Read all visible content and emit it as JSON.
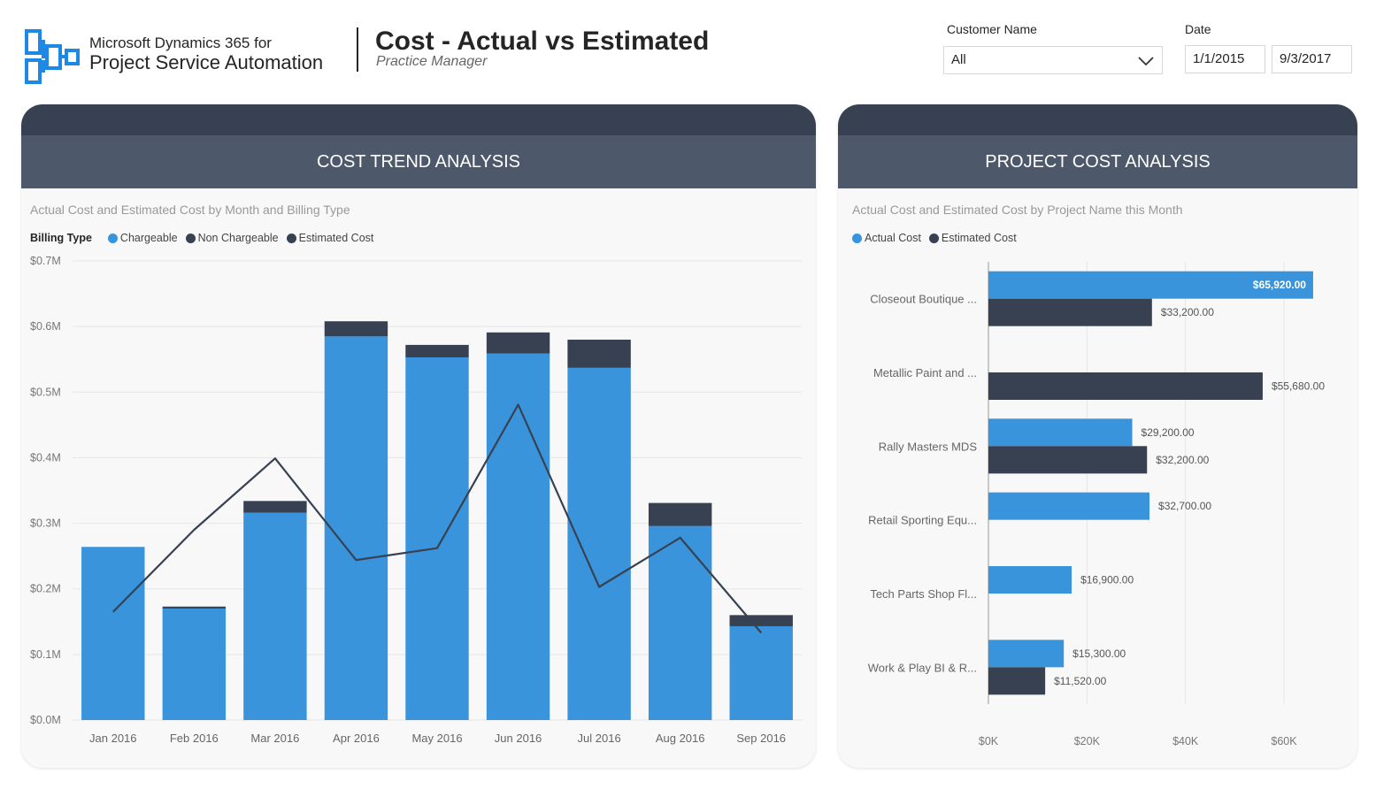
{
  "header": {
    "brand_line1": "Microsoft Dynamics 365 for",
    "brand_line2": "Project Service Automation",
    "title": "Cost - Actual vs Estimated",
    "subtitle": "Practice Manager"
  },
  "filters": {
    "customer_label": "Customer Name",
    "customer_value": "All",
    "date_label": "Date",
    "date_start": "1/1/2015",
    "date_end": "9/3/2017"
  },
  "colors": {
    "actual": "#3a94db",
    "estimated": "#374151",
    "header_bar": "#4d596b"
  },
  "panels": {
    "left": {
      "heading": "COST TREND ANALYSIS",
      "subtitle": "Actual Cost and Estimated Cost by Month and Billing Type",
      "legend_title": "Billing Type",
      "legend": [
        "Chargeable",
        "Non Chargeable",
        "Estimated Cost"
      ]
    },
    "right": {
      "heading": "PROJECT COST ANALYSIS",
      "subtitle": "Actual Cost and Estimated Cost by Project Name this Month",
      "legend": [
        "Actual Cost",
        "Estimated Cost"
      ]
    }
  },
  "chart_data": [
    {
      "type": "bar",
      "stacked": true,
      "categories": [
        "Jan 2016",
        "Feb 2016",
        "Mar 2016",
        "Apr 2016",
        "May 2016",
        "Jun 2016",
        "Jul 2016",
        "Aug 2016",
        "Sep 2016"
      ],
      "series": [
        {
          "name": "Chargeable",
          "kind": "bar",
          "values": [
            0.264,
            0.17,
            0.316,
            0.585,
            0.553,
            0.559,
            0.537,
            0.296,
            0.143
          ]
        },
        {
          "name": "Non Chargeable",
          "kind": "bar",
          "values": [
            0.0,
            0.003,
            0.018,
            0.023,
            0.019,
            0.032,
            0.043,
            0.035,
            0.017
          ]
        },
        {
          "name": "Estimated Cost",
          "kind": "line",
          "values": [
            0.165,
            0.29,
            0.399,
            0.244,
            0.262,
            0.481,
            0.203,
            0.278,
            0.133
          ]
        }
      ],
      "ylim": [
        0,
        0.7
      ],
      "yticks": [
        "$0.0M",
        "$0.1M",
        "$0.2M",
        "$0.3M",
        "$0.4M",
        "$0.5M",
        "$0.6M",
        "$0.7M"
      ],
      "grid": true,
      "legend_position": "top-left"
    },
    {
      "type": "bar",
      "orientation": "horizontal",
      "categories": [
        "Closeout Boutique ...",
        "Metallic Paint and ...",
        "Rally Masters MDS",
        "Retail Sporting Equ...",
        "Tech Parts Shop Fl...",
        "Work & Play BI & R..."
      ],
      "series": [
        {
          "name": "Actual Cost",
          "values": [
            65920,
            null,
            29200,
            32700,
            16900,
            15300
          ],
          "labels": [
            "$65,920.00",
            "",
            "$29,200.00",
            "$32,700.00",
            "$16,900.00",
            "$15,300.00"
          ]
        },
        {
          "name": "Estimated Cost",
          "values": [
            33200,
            55680,
            32200,
            null,
            null,
            11520
          ],
          "labels": [
            "$33,200.00",
            "$55,680.00",
            "$32,200.00",
            "",
            "",
            "$11,520.00"
          ]
        }
      ],
      "xlim": [
        0,
        70000
      ],
      "xticks": [
        "$0K",
        "$20K",
        "$40K",
        "$60K"
      ],
      "grid": true,
      "legend_position": "top-left"
    }
  ]
}
